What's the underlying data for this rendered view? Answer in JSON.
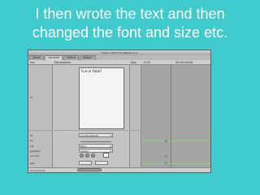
{
  "slide": {
    "caption_line1": "I then wrote the text and then",
    "caption_line2": "changed the font and size etc."
  },
  "window": {
    "title": "Viewer: Text from Sequence 1",
    "tabs": [
      "Video",
      "Controls",
      "Filters",
      "Motion"
    ],
    "active_tab": "Controls",
    "header": {
      "name": "me",
      "parameters": "Parameters",
      "nav": "Nav",
      "tc_start": "0:00",
      "tc_end": "00:00:08:00"
    },
    "text_value": "Fun or Fatal?",
    "rows": {
      "text_label": "xt",
      "font_label": "nt",
      "font_value": "Lucida Grande",
      "size_label": "ze",
      "style_label": "yle",
      "style_value": "Bold",
      "alignment_label": "ignment",
      "alignment_value": "Center",
      "color_label": "nt Color",
      "origin_label": "igin",
      "tracking_label": "acking"
    },
    "timecode": "00:00:01;04"
  },
  "colors": {
    "slide_bg": "#3fcacd",
    "caption_text": "#ffffff",
    "keyframe_line": "#7fd57f"
  }
}
